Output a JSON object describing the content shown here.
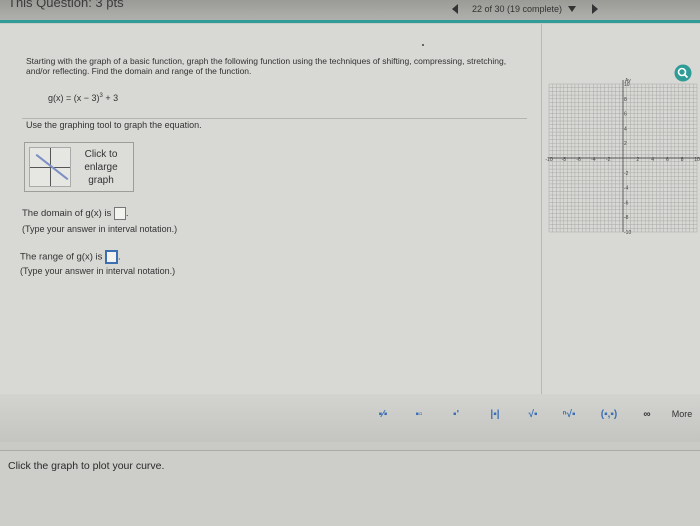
{
  "header": {
    "title": "This Question: 3 pts",
    "progress": "22 of 30 (19 complete)"
  },
  "question": {
    "instructions": "Starting with the graph of a basic function, graph the following function using the techniques of shifting, compressing, stretching, and/or reflecting. Find the domain and range of the function.",
    "function_lhs": "g(x) = (x − 3)",
    "function_exp": "3",
    "function_rhs": " + 3",
    "use_tool": "Use the graphing tool to graph the equation.",
    "enlarge_label": "Click to enlarge graph",
    "domain_label": "The domain of g(x) is",
    "domain_note": "(Type your answer in interval notation.)",
    "range_label": "The range of g(x) is",
    "range_note": "(Type your answer in interval notation.)"
  },
  "graph": {
    "x_ticks": [
      "-10",
      "-8",
      "-6",
      "-4",
      "-2",
      "2",
      "4",
      "6",
      "8",
      "10"
    ],
    "y_ticks": [
      "10",
      "8",
      "6",
      "4",
      "2",
      "-2",
      "-4",
      "-6",
      "-8",
      "-10"
    ],
    "x_label": "x",
    "y_label": "Ay",
    "grid": true
  },
  "toolbar": {
    "buttons": [
      "fraction",
      "mixed-number",
      "exponent",
      "absolute-value",
      "square-root",
      "nth-root",
      "interval",
      "infinity"
    ],
    "more_label": "More"
  },
  "status": {
    "text": "Click the graph to plot your curve."
  },
  "colors": {
    "accent": "#2f9c97",
    "tool_blue": "#3a6fb3"
  }
}
